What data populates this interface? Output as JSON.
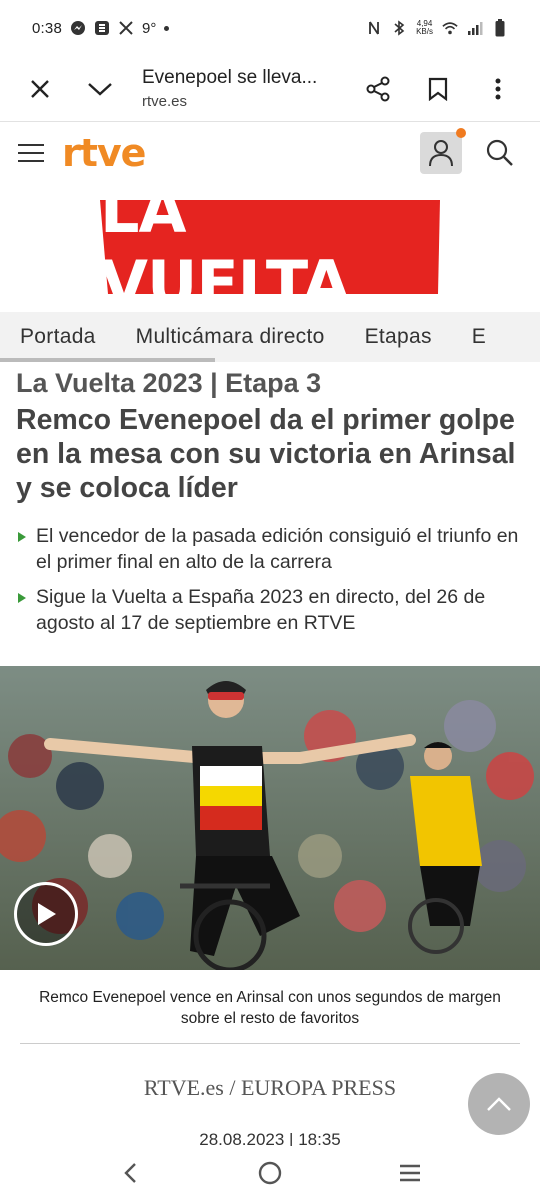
{
  "status_bar": {
    "time": "0:38",
    "temperature": "9°",
    "net_speed_value": "4,94",
    "net_speed_unit": "KB/s"
  },
  "browser": {
    "page_title": "Evenepoel se lleva...",
    "domain": "rtve.es"
  },
  "site": {
    "logo_text": "rtve",
    "accent_color": "#f08a24",
    "banner_text": "LA VUELTA",
    "banner_color": "#e52420"
  },
  "nav_tabs": [
    {
      "label": "Portada"
    },
    {
      "label": "Multicámara directo"
    },
    {
      "label": "Etapas"
    },
    {
      "label": "E"
    }
  ],
  "article": {
    "kicker": "La Vuelta 2023 | Etapa 3",
    "headline": "Remco Evenepoel da el primer golpe en la mesa con su victoria en Arinsal y se coloca líder",
    "bullets": [
      "El vencedor de la pasada edición consiguió el triunfo en el primer final en alto de la carrera",
      "Sigue la Vuelta a España 2023 en directo, del 26 de agosto al 17 de septiembre en RTVE"
    ],
    "caption": "Remco Evenepoel vence en Arinsal con unos segundos de margen sobre el resto de favoritos",
    "source": "RTVE.es / EUROPA PRESS",
    "date": "28.08.2023 | 18:35"
  }
}
